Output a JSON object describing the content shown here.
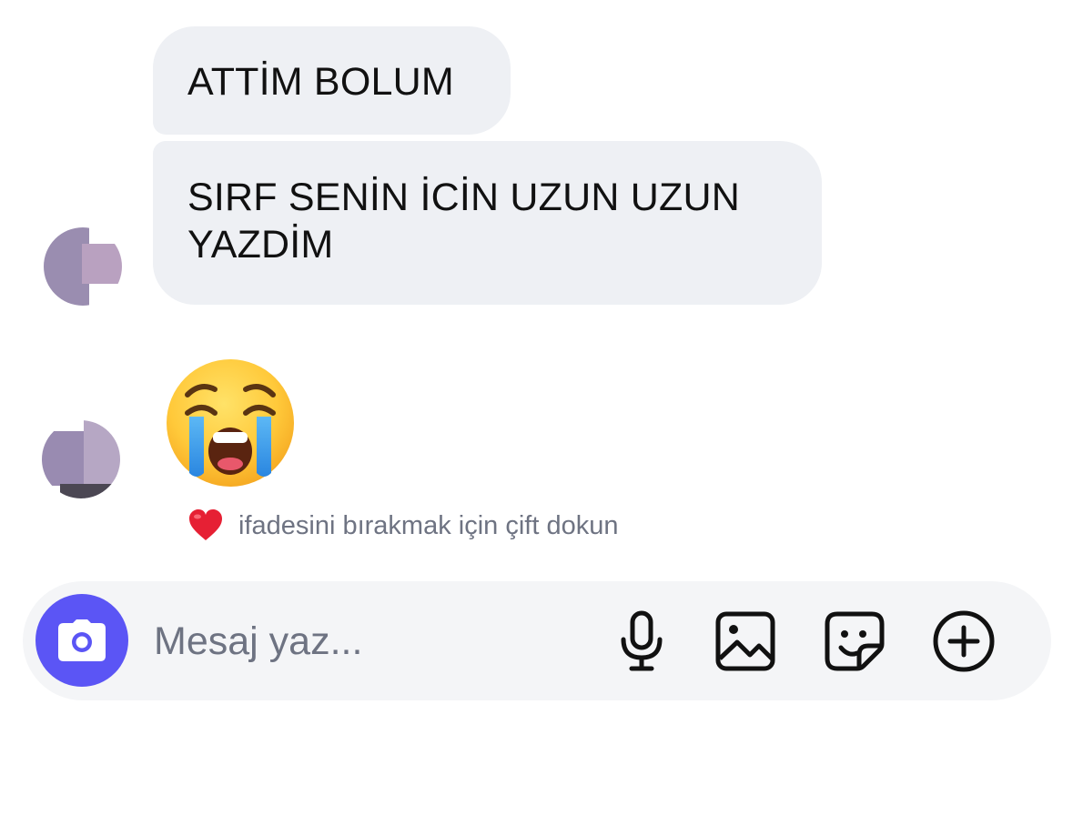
{
  "messages": [
    {
      "text": "ATTİM BOLUM"
    },
    {
      "text": "SIRF SENİN İCİN UZUN UZUN YAZDİM"
    },
    {
      "emoji": "loudly-crying-face"
    }
  ],
  "reaction_hint": {
    "icon": "red-heart",
    "text": "ifadesini bırakmak için çift dokun"
  },
  "composer": {
    "placeholder": "Mesaj yaz...",
    "camera_icon": "camera-icon",
    "tools": [
      "microphone-icon",
      "gallery-icon",
      "sticker-icon",
      "plus-icon"
    ]
  },
  "colors": {
    "accent": "#5b55f5",
    "bubble": "#eef0f4",
    "composer_bg": "#f4f5f7",
    "muted_text": "#6e7382"
  }
}
